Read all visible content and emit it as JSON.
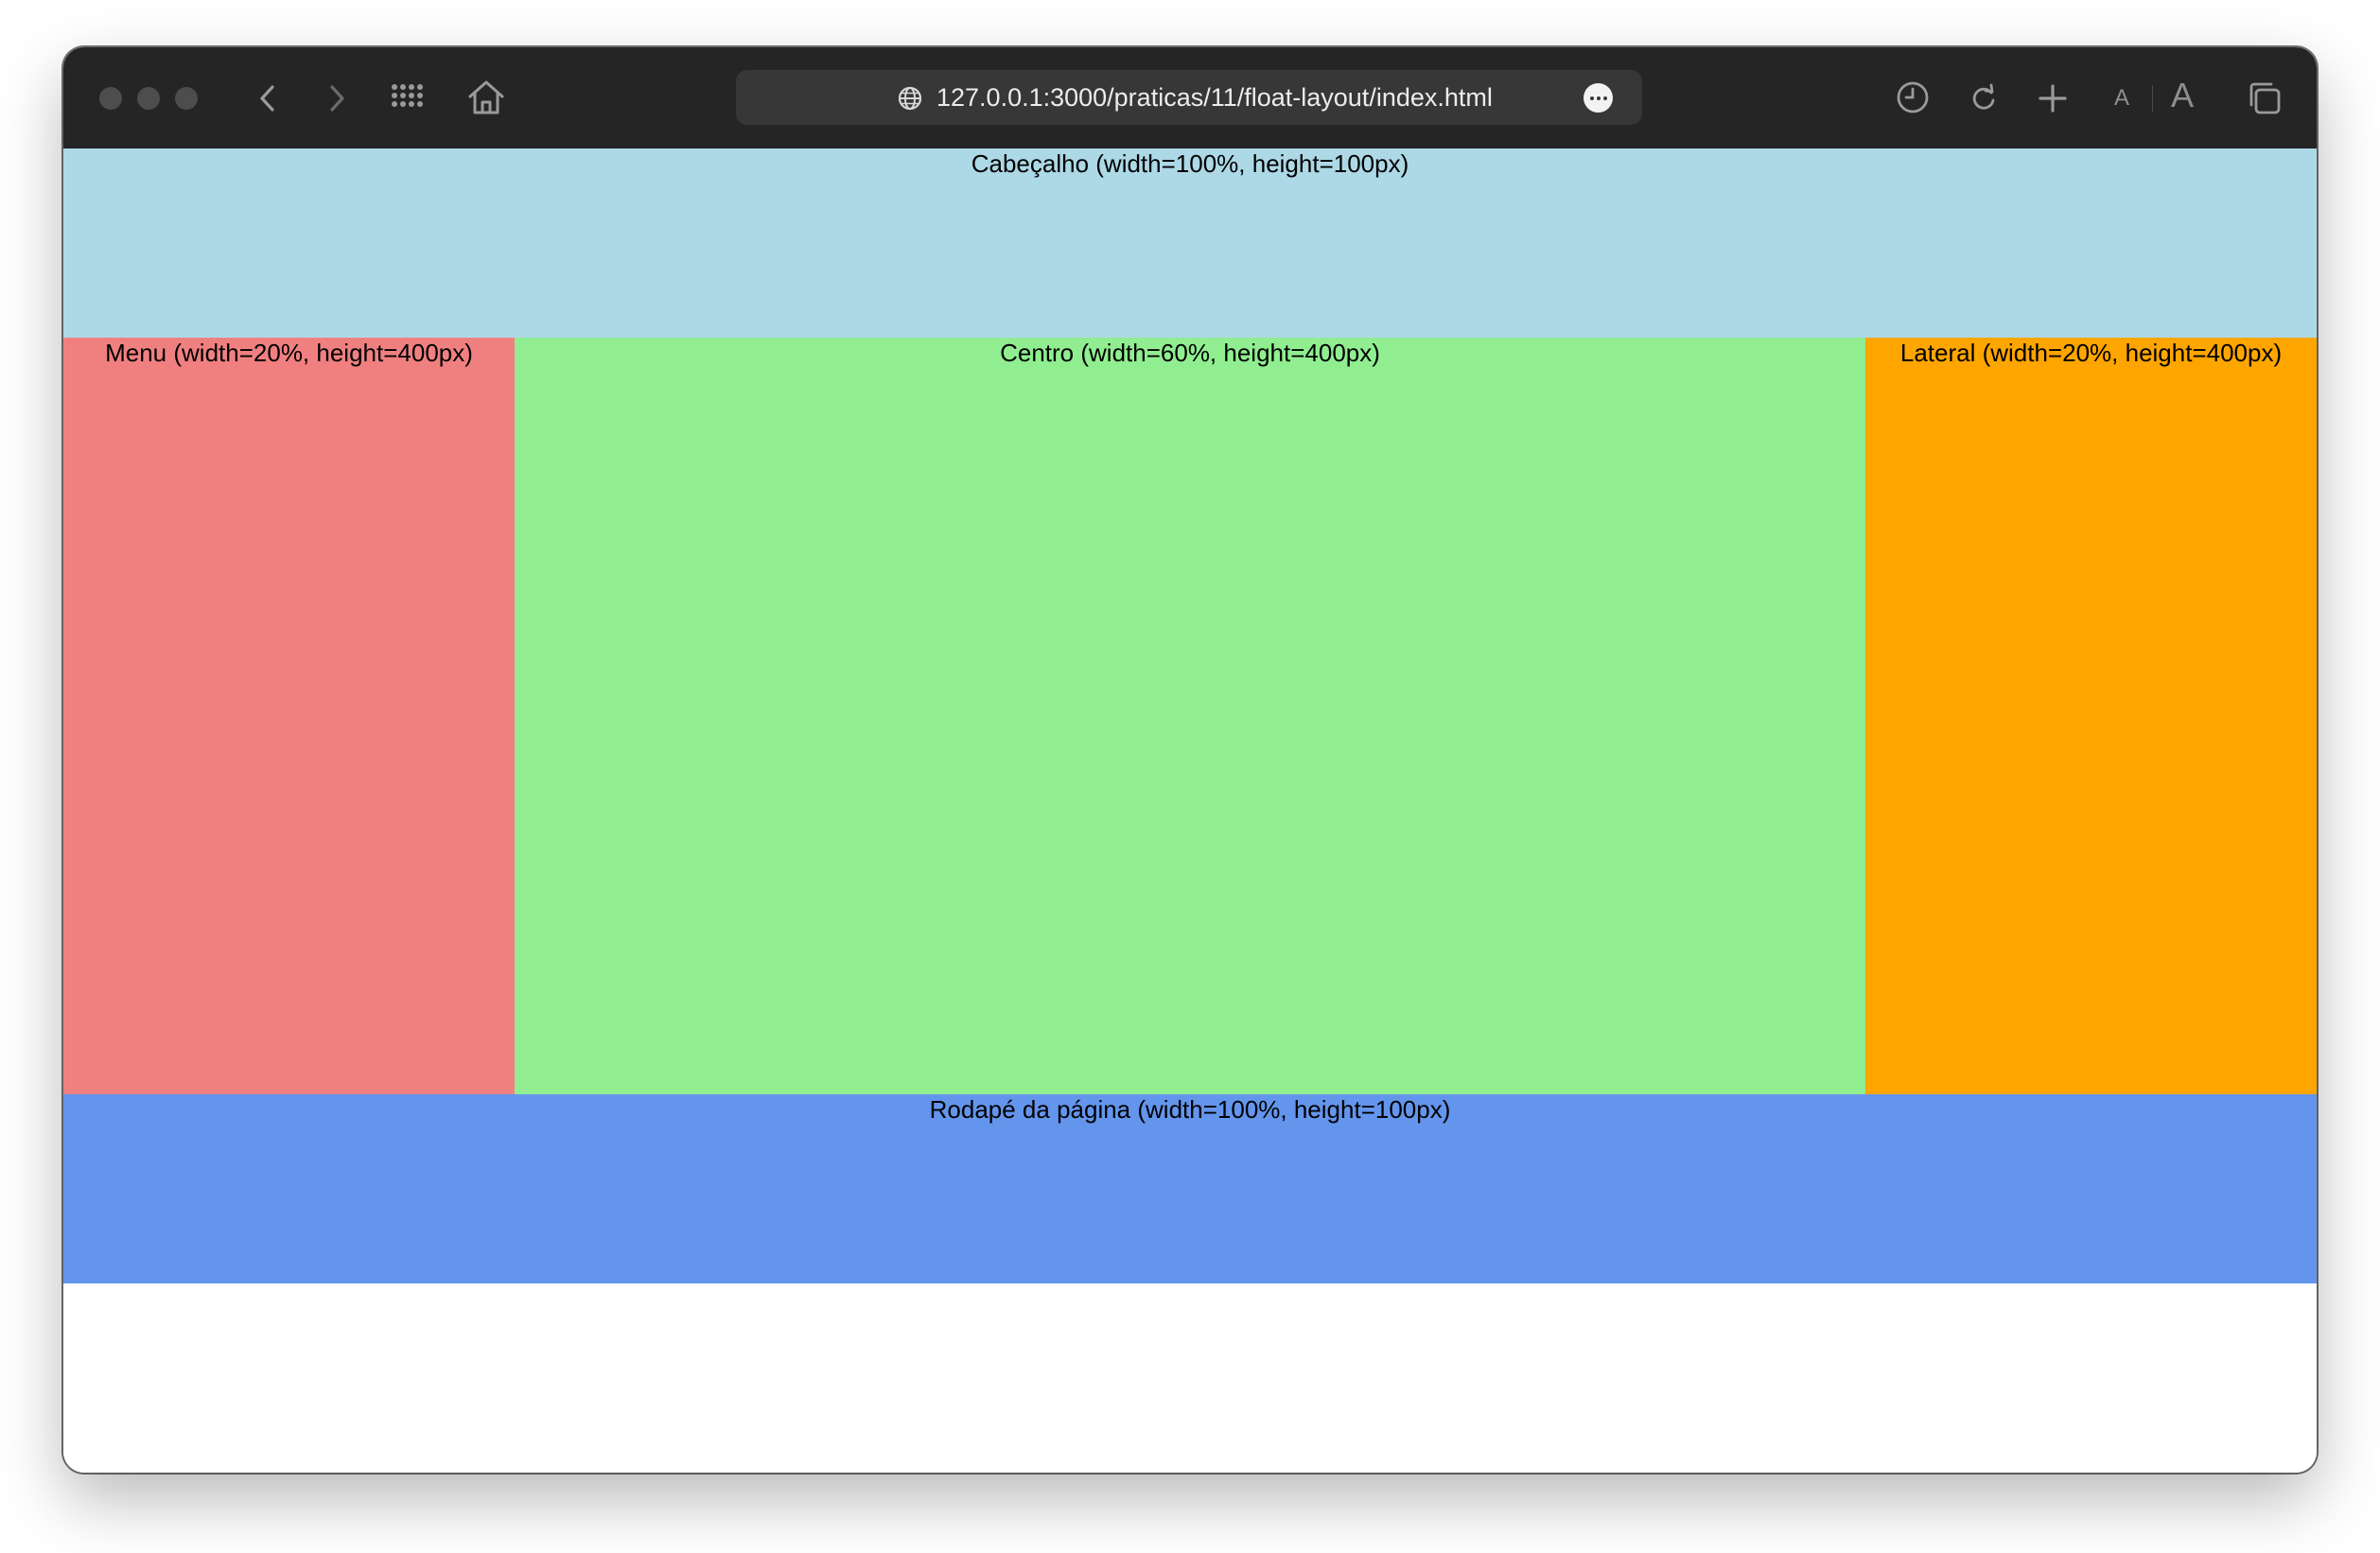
{
  "browser": {
    "url": "127.0.0.1:3000/praticas/11/float-layout/index.html",
    "icons": {
      "close": "traffic-light-close",
      "minimize": "traffic-light-minimize",
      "zoom": "traffic-light-zoom",
      "back": "chevron-left-icon",
      "forward": "chevron-right-icon",
      "grid": "grid-icon",
      "home": "home-icon",
      "globe": "globe-icon",
      "more": "ellipsis-icon",
      "history": "clock-icon",
      "reload": "reload-icon",
      "new_tab": "plus-icon",
      "tabs": "tabs-icon"
    },
    "font_small_label": "A",
    "font_large_label": "A"
  },
  "page": {
    "header": {
      "label": "Cabeçalho (width=100%, height=100px)",
      "color": "#add8e6"
    },
    "menu": {
      "label": "Menu (width=20%, height=400px)",
      "color": "#f08080"
    },
    "center": {
      "label": "Centro (width=60%, height=400px)",
      "color": "#90ee90"
    },
    "lateral": {
      "label": "Lateral (width=20%, height=400px)",
      "color": "#ffa500"
    },
    "footer": {
      "label": "Rodapé da página (width=100%, height=100px)",
      "color": "#6495ed"
    }
  }
}
